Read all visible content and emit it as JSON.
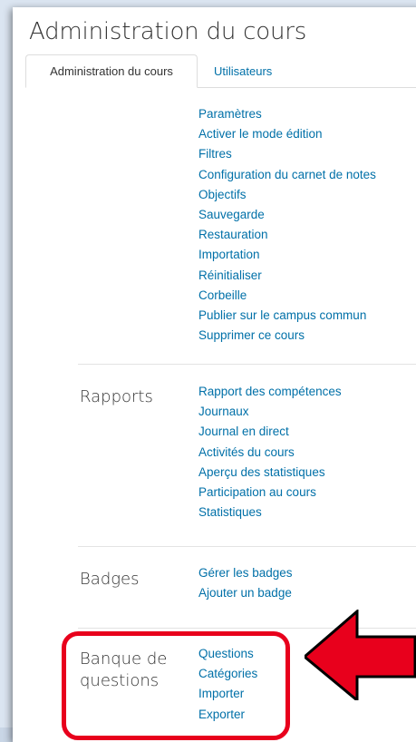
{
  "page": {
    "title": "Administration du cours"
  },
  "tabs": [
    {
      "label": "Administration du cours",
      "active": true
    },
    {
      "label": "Utilisateurs",
      "active": false
    }
  ],
  "sections": {
    "course": {
      "links": [
        "Paramètres",
        "Activer le mode édition",
        "Filtres",
        "Configuration du carnet de notes",
        "Objectifs",
        "Sauvegarde",
        "Restauration",
        "Importation",
        "Réinitialiser",
        "Corbeille",
        "Publier sur le campus commun",
        "Supprimer ce cours"
      ]
    },
    "reports": {
      "title": "Rapports",
      "links": [
        "Rapport des compétences",
        "Journaux",
        "Journal en direct",
        "Activités du cours",
        "Aperçu des statistiques",
        "Participation au cours",
        "Statistiques"
      ]
    },
    "badges": {
      "title": "Badges",
      "links": [
        "Gérer les badges",
        "Ajouter un badge"
      ]
    },
    "question_bank": {
      "title_line1": "Banque de",
      "title_line2": "questions",
      "links": [
        "Questions",
        "Catégories",
        "Importer",
        "Exporter"
      ]
    }
  },
  "colors": {
    "link": "#0070a8",
    "highlight": "#e8001c",
    "arrow_fill": "#e8001c"
  }
}
